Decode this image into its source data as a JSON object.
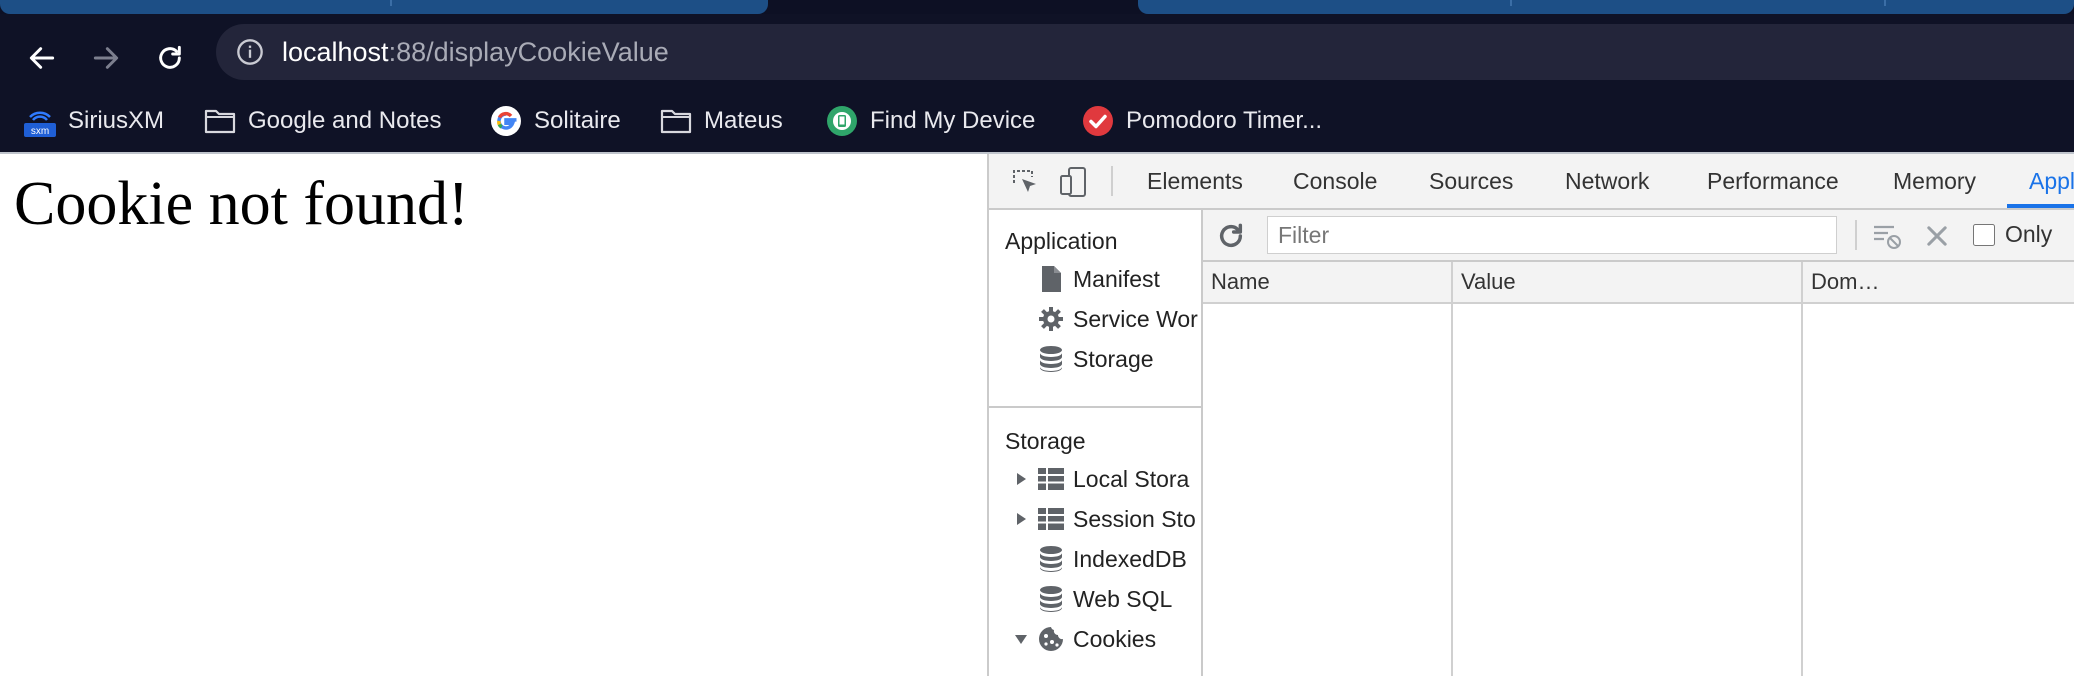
{
  "browser": {
    "url_host": "localhost",
    "url_path": ":88/displayCookieValue",
    "bookmarks": [
      {
        "label": "SiriusXM",
        "icon": "siriusxm-icon"
      },
      {
        "label": "Google and Notes",
        "icon": "folder-icon"
      },
      {
        "label": "Solitaire",
        "icon": "google-icon"
      },
      {
        "label": "Mateus",
        "icon": "folder-icon"
      },
      {
        "label": "Find My Device",
        "icon": "find-my-device-icon"
      },
      {
        "label": "Pomodoro Timer...",
        "icon": "pomodoro-check-icon"
      }
    ],
    "siriusxm_badge": "sxm"
  },
  "page": {
    "heading": "Cookie not found!"
  },
  "devtools": {
    "tabs": [
      "Elements",
      "Console",
      "Sources",
      "Network",
      "Performance",
      "Memory",
      "Appl"
    ],
    "active_tab": "Appl",
    "sidebar": {
      "application_header": "Application",
      "application_items": [
        {
          "label": "Manifest",
          "icon": "document-icon"
        },
        {
          "label": "Service Wor",
          "icon": "gear-icon"
        },
        {
          "label": "Storage",
          "icon": "database-icon"
        }
      ],
      "storage_header": "Storage",
      "storage_items": [
        {
          "label": "Local Stora",
          "icon": "table-icon",
          "expander": "collapsed"
        },
        {
          "label": "Session Sto",
          "icon": "table-icon",
          "expander": "collapsed"
        },
        {
          "label": "IndexedDB",
          "icon": "database-icon",
          "expander": "none"
        },
        {
          "label": "Web SQL",
          "icon": "database-icon",
          "expander": "none"
        },
        {
          "label": "Cookies",
          "icon": "cookie-icon",
          "expander": "expanded"
        }
      ]
    },
    "filter": {
      "placeholder": "Filter",
      "value": "",
      "only_label": "Only"
    },
    "table": {
      "columns": [
        "Name",
        "Value",
        "Dom…"
      ],
      "rows": []
    }
  },
  "colors": {
    "chrome_bg": "#0f1226",
    "accent": "#1a73e8",
    "pomodoro_red": "#e0393e",
    "find_my_device_green": "#2fa56a"
  }
}
